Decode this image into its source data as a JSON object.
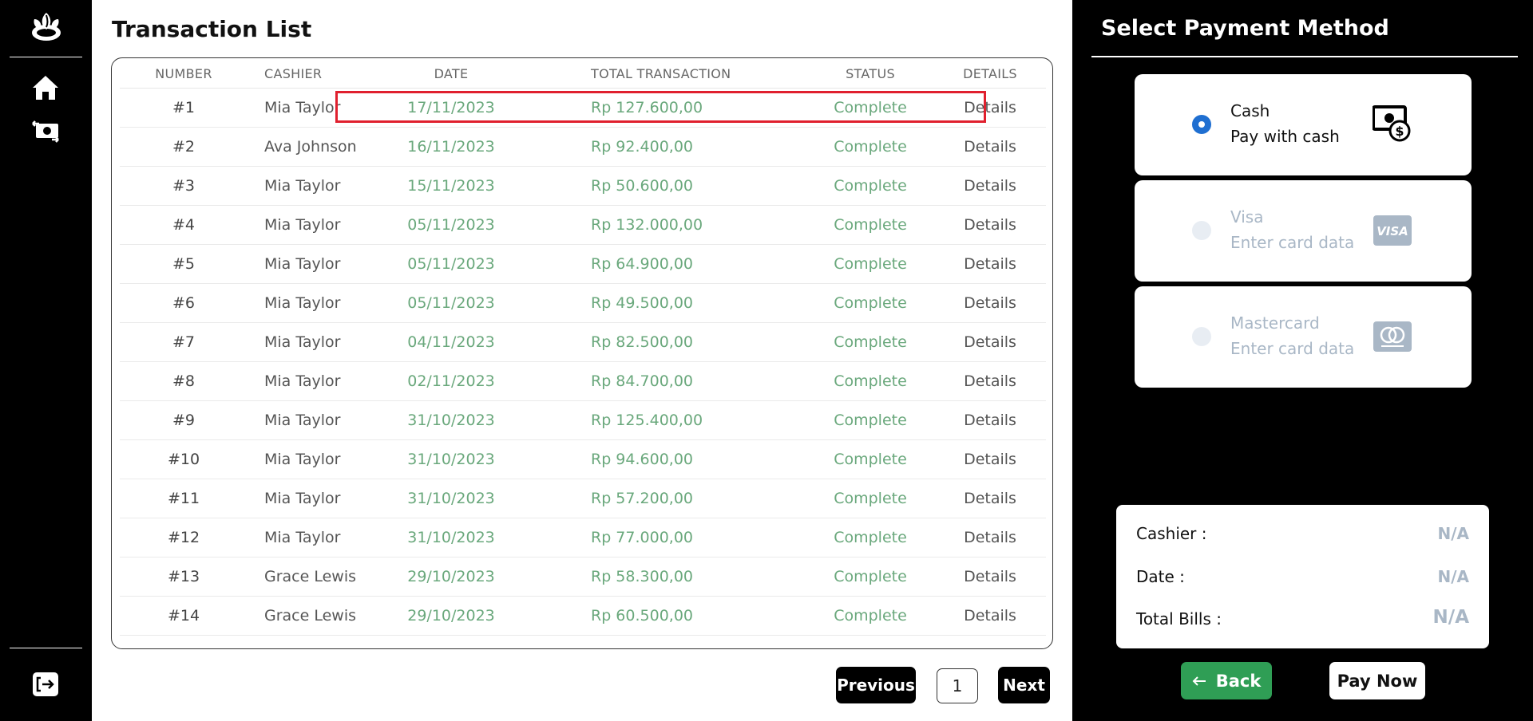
{
  "main": {
    "title": "Transaction List",
    "columns": {
      "number": "NUMBER",
      "cashier": "CASHIER",
      "date": "DATE",
      "total": "TOTAL TRANSACTION",
      "status": "STATUS",
      "details": "DETAILS"
    },
    "rows": [
      {
        "number": "#1",
        "cashier": "Mia Taylor",
        "date": "17/11/2023",
        "total": "Rp 127.600,00",
        "status": "Complete",
        "details": "Details"
      },
      {
        "number": "#2",
        "cashier": "Ava Johnson",
        "date": "16/11/2023",
        "total": "Rp 92.400,00",
        "status": "Complete",
        "details": "Details"
      },
      {
        "number": "#3",
        "cashier": "Mia Taylor",
        "date": "15/11/2023",
        "total": "Rp 50.600,00",
        "status": "Complete",
        "details": "Details"
      },
      {
        "number": "#4",
        "cashier": "Mia Taylor",
        "date": "05/11/2023",
        "total": "Rp 132.000,00",
        "status": "Complete",
        "details": "Details"
      },
      {
        "number": "#5",
        "cashier": "Mia Taylor",
        "date": "05/11/2023",
        "total": "Rp 64.900,00",
        "status": "Complete",
        "details": "Details"
      },
      {
        "number": "#6",
        "cashier": "Mia Taylor",
        "date": "05/11/2023",
        "total": "Rp 49.500,00",
        "status": "Complete",
        "details": "Details"
      },
      {
        "number": "#7",
        "cashier": "Mia Taylor",
        "date": "04/11/2023",
        "total": "Rp 82.500,00",
        "status": "Complete",
        "details": "Details"
      },
      {
        "number": "#8",
        "cashier": "Mia Taylor",
        "date": "02/11/2023",
        "total": "Rp 84.700,00",
        "status": "Complete",
        "details": "Details"
      },
      {
        "number": "#9",
        "cashier": "Mia Taylor",
        "date": "31/10/2023",
        "total": "Rp 125.400,00",
        "status": "Complete",
        "details": "Details"
      },
      {
        "number": "#10",
        "cashier": "Mia Taylor",
        "date": "31/10/2023",
        "total": "Rp 94.600,00",
        "status": "Complete",
        "details": "Details"
      },
      {
        "number": "#11",
        "cashier": "Mia Taylor",
        "date": "31/10/2023",
        "total": "Rp 57.200,00",
        "status": "Complete",
        "details": "Details"
      },
      {
        "number": "#12",
        "cashier": "Mia Taylor",
        "date": "31/10/2023",
        "total": "Rp 77.000,00",
        "status": "Complete",
        "details": "Details"
      },
      {
        "number": "#13",
        "cashier": "Grace Lewis",
        "date": "29/10/2023",
        "total": "Rp 58.300,00",
        "status": "Complete",
        "details": "Details"
      },
      {
        "number": "#14",
        "cashier": "Grace Lewis",
        "date": "29/10/2023",
        "total": "Rp 60.500,00",
        "status": "Complete",
        "details": "Details"
      }
    ],
    "pagination": {
      "previous": "Previous",
      "page": "1",
      "next": "Next"
    }
  },
  "payment": {
    "title": "Select Payment Method",
    "methods": [
      {
        "name": "Cash",
        "sub": "Pay with cash",
        "icon": "cash-icon",
        "selected": true
      },
      {
        "name": "Visa",
        "sub": "Enter card data",
        "icon": "visa-icon",
        "selected": false
      },
      {
        "name": "Mastercard",
        "sub": "Enter card data",
        "icon": "mastercard-icon",
        "selected": false
      }
    ],
    "summary": {
      "cashier_label": "Cashier :",
      "cashier_value": "N/A",
      "date_label": "Date :",
      "date_value": "N/A",
      "total_label": "Total Bills :",
      "total_value": "N/A"
    },
    "back_label": "Back",
    "pay_label": "Pay Now"
  },
  "colors": {
    "accent_green": "#2f9e55",
    "value_green": "#6aa87c",
    "highlight_red": "#e0202e",
    "radio_blue": "#1f6fd1",
    "muted": "#a9b7c6"
  }
}
